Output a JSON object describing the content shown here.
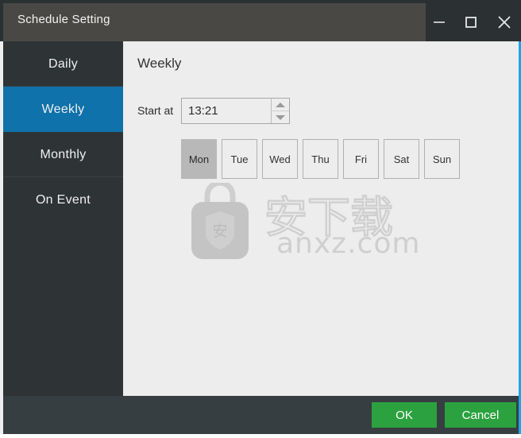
{
  "window": {
    "title": "Schedule Setting",
    "controls": {
      "minimize": "minimize-icon",
      "maximize": "maximize-icon",
      "close": "close-icon"
    },
    "accent_border_color": "#1aa6e8",
    "titlebar_color": "#4a4845"
  },
  "sidebar": {
    "active_color": "#0f72ab",
    "background_color": "#2e3336",
    "items": [
      {
        "label": "Daily",
        "active": false
      },
      {
        "label": "Weekly",
        "active": true
      },
      {
        "label": "Monthly",
        "active": false
      },
      {
        "label": "On Event",
        "active": false
      }
    ]
  },
  "content": {
    "pane_title": "Weekly",
    "start_at": {
      "label": "Start at",
      "value": "13:21",
      "spin_up": "up-arrow-icon",
      "spin_down": "down-arrow-icon"
    },
    "days": [
      {
        "label": "Mon",
        "selected": true
      },
      {
        "label": "Tue",
        "selected": false
      },
      {
        "label": "Wed",
        "selected": false
      },
      {
        "label": "Thu",
        "selected": false
      },
      {
        "label": "Fri",
        "selected": false
      },
      {
        "label": "Sat",
        "selected": false
      },
      {
        "label": "Sun",
        "selected": false
      }
    ],
    "watermark": {
      "bag_glyph": "安",
      "characters": "安下载",
      "domain": "anxz.com",
      "color": "#cfcfcf"
    }
  },
  "footer": {
    "background_color": "#373e41",
    "ok_label": "OK",
    "cancel_label": "Cancel",
    "button_color": "#2ba23f"
  }
}
